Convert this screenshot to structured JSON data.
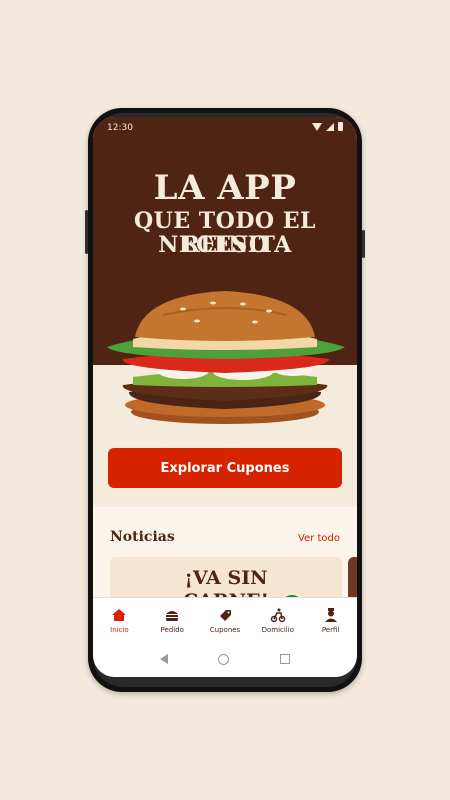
{
  "status_bar": {
    "time": "12:30"
  },
  "hero": {
    "line1": "LA APP",
    "line2": "QUE TODO EL REINO",
    "line3": "NECESITA"
  },
  "cta": {
    "label": "Explorar Cupones"
  },
  "news": {
    "title": "Noticias",
    "view_all": "Ver todo",
    "card_line1": "¡VA SIN",
    "card_line2": "CARNE!"
  },
  "tabs": [
    {
      "label": "Inicio",
      "icon": "home-icon",
      "active": true
    },
    {
      "label": "Pedido",
      "icon": "burger-icon",
      "active": false
    },
    {
      "label": "Cupones",
      "icon": "coupon-icon",
      "active": false
    },
    {
      "label": "Domicilio",
      "icon": "delivery-icon",
      "active": false
    },
    {
      "label": "Perfil",
      "icon": "user-icon",
      "active": false
    }
  ],
  "colors": {
    "brand_red": "#d62300",
    "brand_brown": "#502314",
    "background": "#f5ebdc"
  }
}
